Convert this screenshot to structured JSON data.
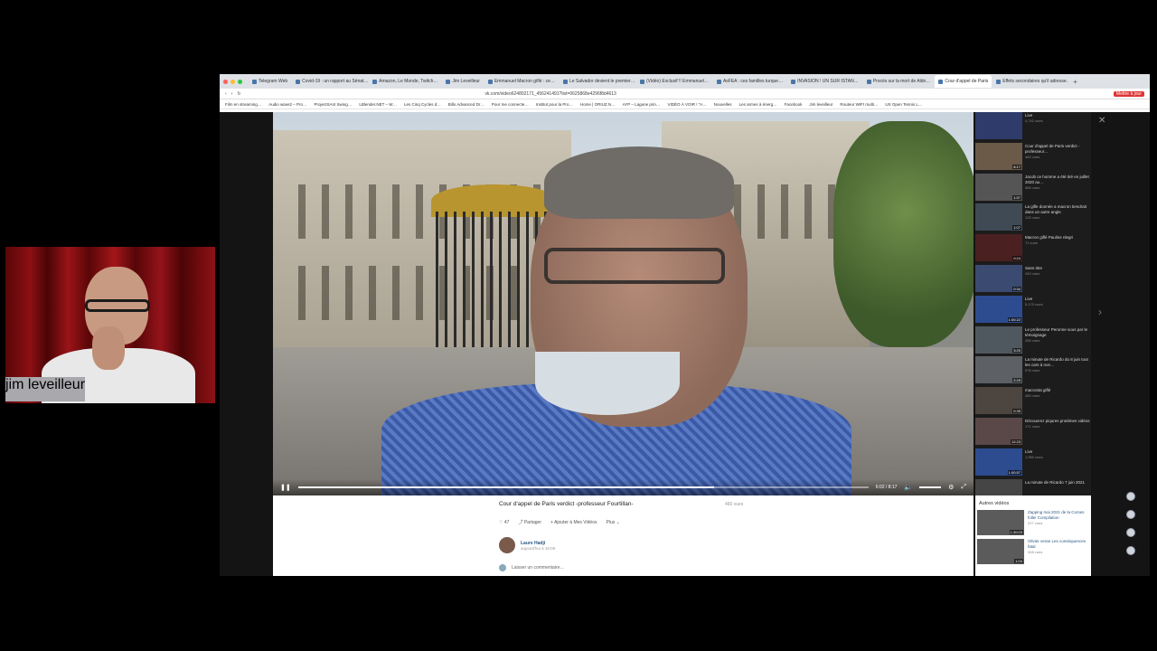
{
  "webcam": {
    "name_tag": "jim leveilleur"
  },
  "browser": {
    "tabs": [
      {
        "label": "Telegram Web",
        "active": false
      },
      {
        "label": "Covid-19 : un rapport au Sénat…",
        "active": false
      },
      {
        "label": "Amazon, Le Monde, Twitch…",
        "active": false
      },
      {
        "label": "Jim Leveilleur",
        "active": false
      },
      {
        "label": "Emmanuel Macron giflé : ce…",
        "active": false
      },
      {
        "label": "Le Salvador devient le premier…",
        "active": false
      },
      {
        "label": "(Vidéo) Exclusif !! Emmanuel…",
        "active": false
      },
      {
        "label": "AsFEA : ces familles turque…",
        "active": false
      },
      {
        "label": "INVASION ! UN SUR ISTAN…",
        "active": false
      },
      {
        "label": "Procès sur la mort de Aldo…",
        "active": false
      },
      {
        "label": "Cour d'appel de Paris",
        "active": true
      },
      {
        "label": "Effets secondaires qu'il adresse…",
        "active": false
      }
    ],
    "url": "vk.com/video624802171_456241491?list=0625868e4296f8d4613",
    "update_button": "Mettre à jour",
    "bookmarks": [
      "Film en streaming…",
      "Audio wave2 – Pro…",
      "ProjectSAI4 Swing…",
      "LBlender.NET – W…",
      "Les Cinq Cycles d…",
      "Billo Advanced Dr…",
      "Pour me connecte…",
      "Institut pour la Pro…",
      "Home | ORIUZ.N…",
      "AYP – Lagune prin…",
      "VIDÉO À VOIR ! \"A…",
      "Nouvelles",
      "Les armes à énerg…",
      "Facebook",
      "Jim leveilleur",
      "Routeur WIFI multi…",
      "US Open Tennis L…"
    ]
  },
  "player": {
    "time": "6:02 / 8:17",
    "progress": 0.73
  },
  "video_info": {
    "title": "Cour d'appel de Paris verdict -professeur Fourtillan-",
    "views": "460 vues",
    "likes": "47",
    "share": "Partager",
    "add": "Ajouter à Mes Vidéos",
    "more": "Plus",
    "author_name": "Laure Hadji",
    "author_date": "aujourd'hui à 16:09",
    "comment_placeholder": "Laisser un commentaire…"
  },
  "playlist": [
    {
      "title": "Live",
      "sub": "4,742 vues",
      "duration": ""
    },
    {
      "title": "Cour d'appel de Paris verdict -professeur…",
      "sub": "460 vues",
      "duration": "8:17"
    },
    {
      "title": "Jacob ce homme a été tiré en juillet 2020 au…",
      "sub": "586 vues",
      "duration": "1:57"
    },
    {
      "title": "La gifle donnée a macron tiendrait dans un autre angle",
      "sub": "125 vues",
      "duration": "1:07"
    },
    {
      "title": "Macron giflé Pauline nlegri",
      "sub": "71 vues",
      "duration": "0:24"
    },
    {
      "title": "Sans titre",
      "sub": "240 vues",
      "duration": "0:34"
    },
    {
      "title": "Live",
      "sub": "5,170 vues",
      "duration": "1:00:22"
    },
    {
      "title": "Le professeur Peronne sous par le témoignage",
      "sub": "256 vues",
      "duration": "3:20"
    },
    {
      "title": "La minute de Ricardo du 8 juin tout les cars à nos…",
      "sub": "576 vues",
      "duration": "2:29"
    },
    {
      "title": "macronta giflé",
      "sub": "480 vues",
      "duration": "0:35"
    },
    {
      "title": "Découvrez piqures protéines vidéos",
      "sub": "171 vues",
      "duration": "12:23"
    },
    {
      "title": "Live",
      "sub": "1,950 vues",
      "duration": "1:00:57"
    },
    {
      "title": "La minute de Ricardo 7 juin 2021",
      "sub": "",
      "duration": ""
    }
  ],
  "others": {
    "heading": "Autres vidéos",
    "items": [
      {
        "title": "Zapping mai 2021 de la Corses folle! Compilation",
        "sub": "227 vues",
        "duration": "1:30:03"
      },
      {
        "title": "Olivier veran Les conséquences fatal",
        "sub": "408 vues",
        "duration": "1:04"
      }
    ]
  },
  "colors": {
    "link": "#2a5885",
    "update_button": "#dd3333",
    "playlist_bg": "#1c1c1c"
  }
}
